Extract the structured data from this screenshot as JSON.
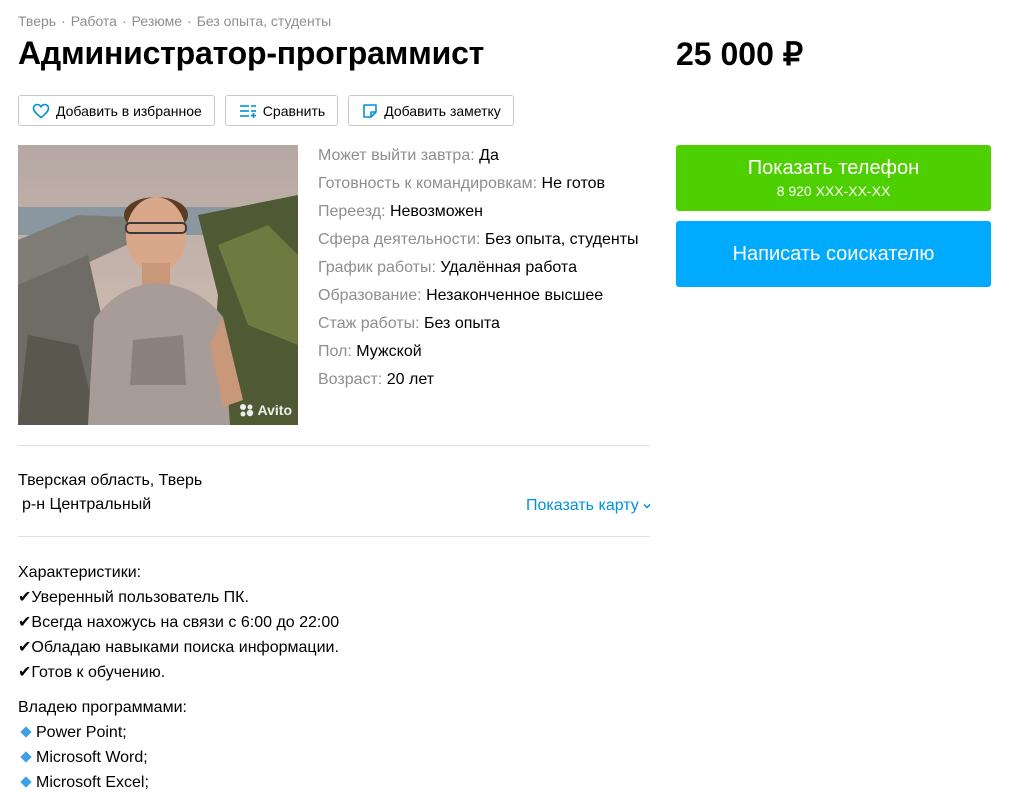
{
  "breadcrumbs": [
    "Тверь",
    "Работа",
    "Резюме",
    "Без опыта, студенты"
  ],
  "title": "Администратор-программист",
  "price": "25 000 ₽",
  "actions": {
    "favorite": "Добавить в избранное",
    "compare": "Сравнить",
    "note": "Добавить заметку"
  },
  "photo": {
    "watermark": "Avito"
  },
  "params": [
    {
      "key": "Может выйти завтра:",
      "value": "Да"
    },
    {
      "key": "Готовность к командировкам:",
      "value": "Не готов"
    },
    {
      "key": "Переезд:",
      "value": "Невозможен"
    },
    {
      "key": "Сфера деятельности:",
      "value": "Без опыта, студенты"
    },
    {
      "key": "График работы:",
      "value": "Удалённая работа"
    },
    {
      "key": "Образование:",
      "value": "Незаконченное высшее"
    },
    {
      "key": "Стаж работы:",
      "value": "Без опыта"
    },
    {
      "key": "Пол:",
      "value": "Мужской"
    },
    {
      "key": "Возраст:",
      "value": "20 лет"
    }
  ],
  "address": {
    "region": "Тверская область, Тверь",
    "district": "р-н Центральный",
    "map_link": "Показать карту"
  },
  "description": {
    "skills_title": "Характеристики:",
    "skills": [
      "Уверенный пользователь ПК.",
      "Всегда нахожусь на связи с 6:00 до 22:00",
      "Обладаю навыками поиска информации.",
      "Готов к обучению."
    ],
    "programs_title": "Владею программами:",
    "programs": [
      "Power Point;",
      "Microsoft Word;",
      "Microsoft Excel;"
    ]
  },
  "contact": {
    "show_phone": "Показать телефон",
    "phone_masked": "8 920 XXX-XX-XX",
    "write": "Написать соискателю"
  },
  "colors": {
    "green": "#4ed000",
    "blue": "#00aaff",
    "link": "#0092d9",
    "muted": "#8e8e8e"
  }
}
